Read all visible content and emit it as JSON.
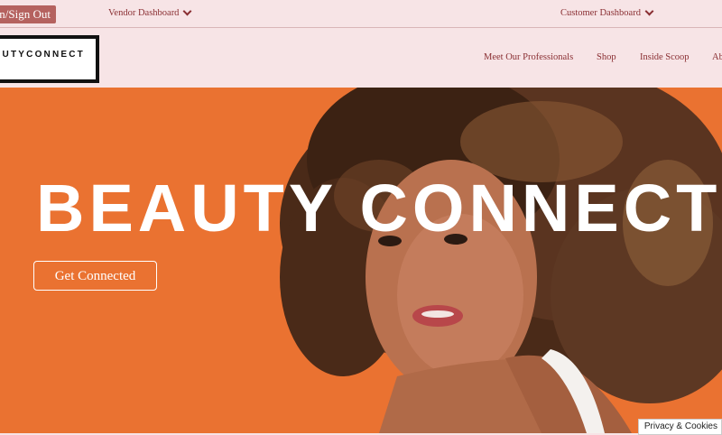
{
  "topbar": {
    "signout_label": "n/Sign Out",
    "vendor_dashboard": "Vendor Dashboard",
    "customer_dashboard": "Customer Dashboard"
  },
  "header": {
    "logo_text": "UTYCONNECT",
    "nav": [
      "Meet Our Professionals",
      "Shop",
      "Inside Scoop",
      "Ab"
    ]
  },
  "hero": {
    "title": "BEAUTY CONNECT",
    "cta_label": "Get Connected"
  },
  "cookie_label": "Privacy & Cookies",
  "colors": {
    "background": "#f7e4e6",
    "accent": "#8a2f33",
    "signout_bg": "#b5625f",
    "hero_bg": "#ea7231"
  },
  "icons": [
    "chevron-down-icon"
  ]
}
